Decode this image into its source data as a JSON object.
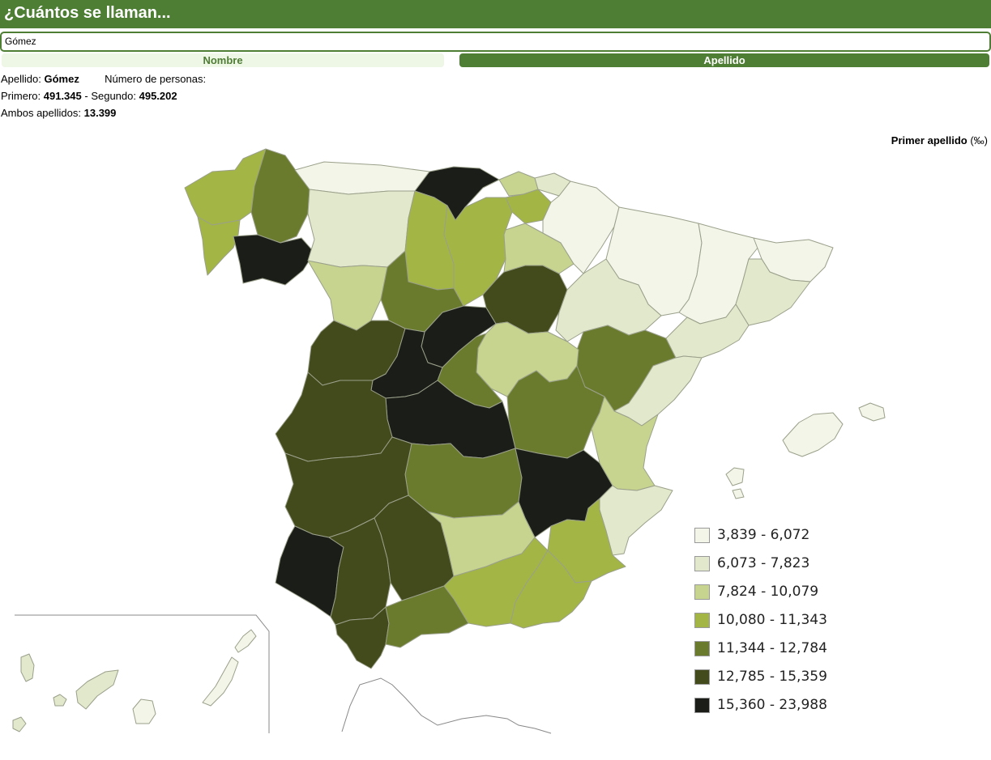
{
  "header": {
    "title": "¿Cuántos se llaman..."
  },
  "search": {
    "value": "Gómez"
  },
  "tabs": [
    {
      "label": "Nombre",
      "active": false
    },
    {
      "label": "Apellido",
      "active": true
    }
  ],
  "info": {
    "apellido_label": "Apellido:",
    "apellido_value": "Gómez",
    "personas_label": "Número de personas:",
    "primero_label": "Primero:",
    "primero_value": "491.345",
    "segundo_label": "- Segundo:",
    "segundo_value": "495.202",
    "ambos_label": "Ambos apellidos:",
    "ambos_value": "13.399"
  },
  "map": {
    "title": "Primer apellido",
    "unit": "(‰)",
    "legend": [
      {
        "label": "3,839 - 6,072",
        "color": "#f2f5e8"
      },
      {
        "label": "6,073 - 7,823",
        "color": "#e1e8cc"
      },
      {
        "label": "7,824 - 10,079",
        "color": "#c6d48f"
      },
      {
        "label": "10,080 - 11,343",
        "color": "#a3b545"
      },
      {
        "label": "11,344 - 12,784",
        "color": "#6b7b2e"
      },
      {
        "label": "12,785 - 15,359",
        "color": "#434a1b"
      },
      {
        "label": "15,360 - 23,988",
        "color": "#1b1e18"
      }
    ],
    "colors": {
      "c1": "#f2f5e8",
      "c2": "#e1e8cc",
      "c3": "#c6d48f",
      "c4": "#a3b545",
      "c5": "#6b7b2e",
      "c6": "#434a1b",
      "c7": "#1b1e18",
      "border": "#9aa08a"
    }
  }
}
